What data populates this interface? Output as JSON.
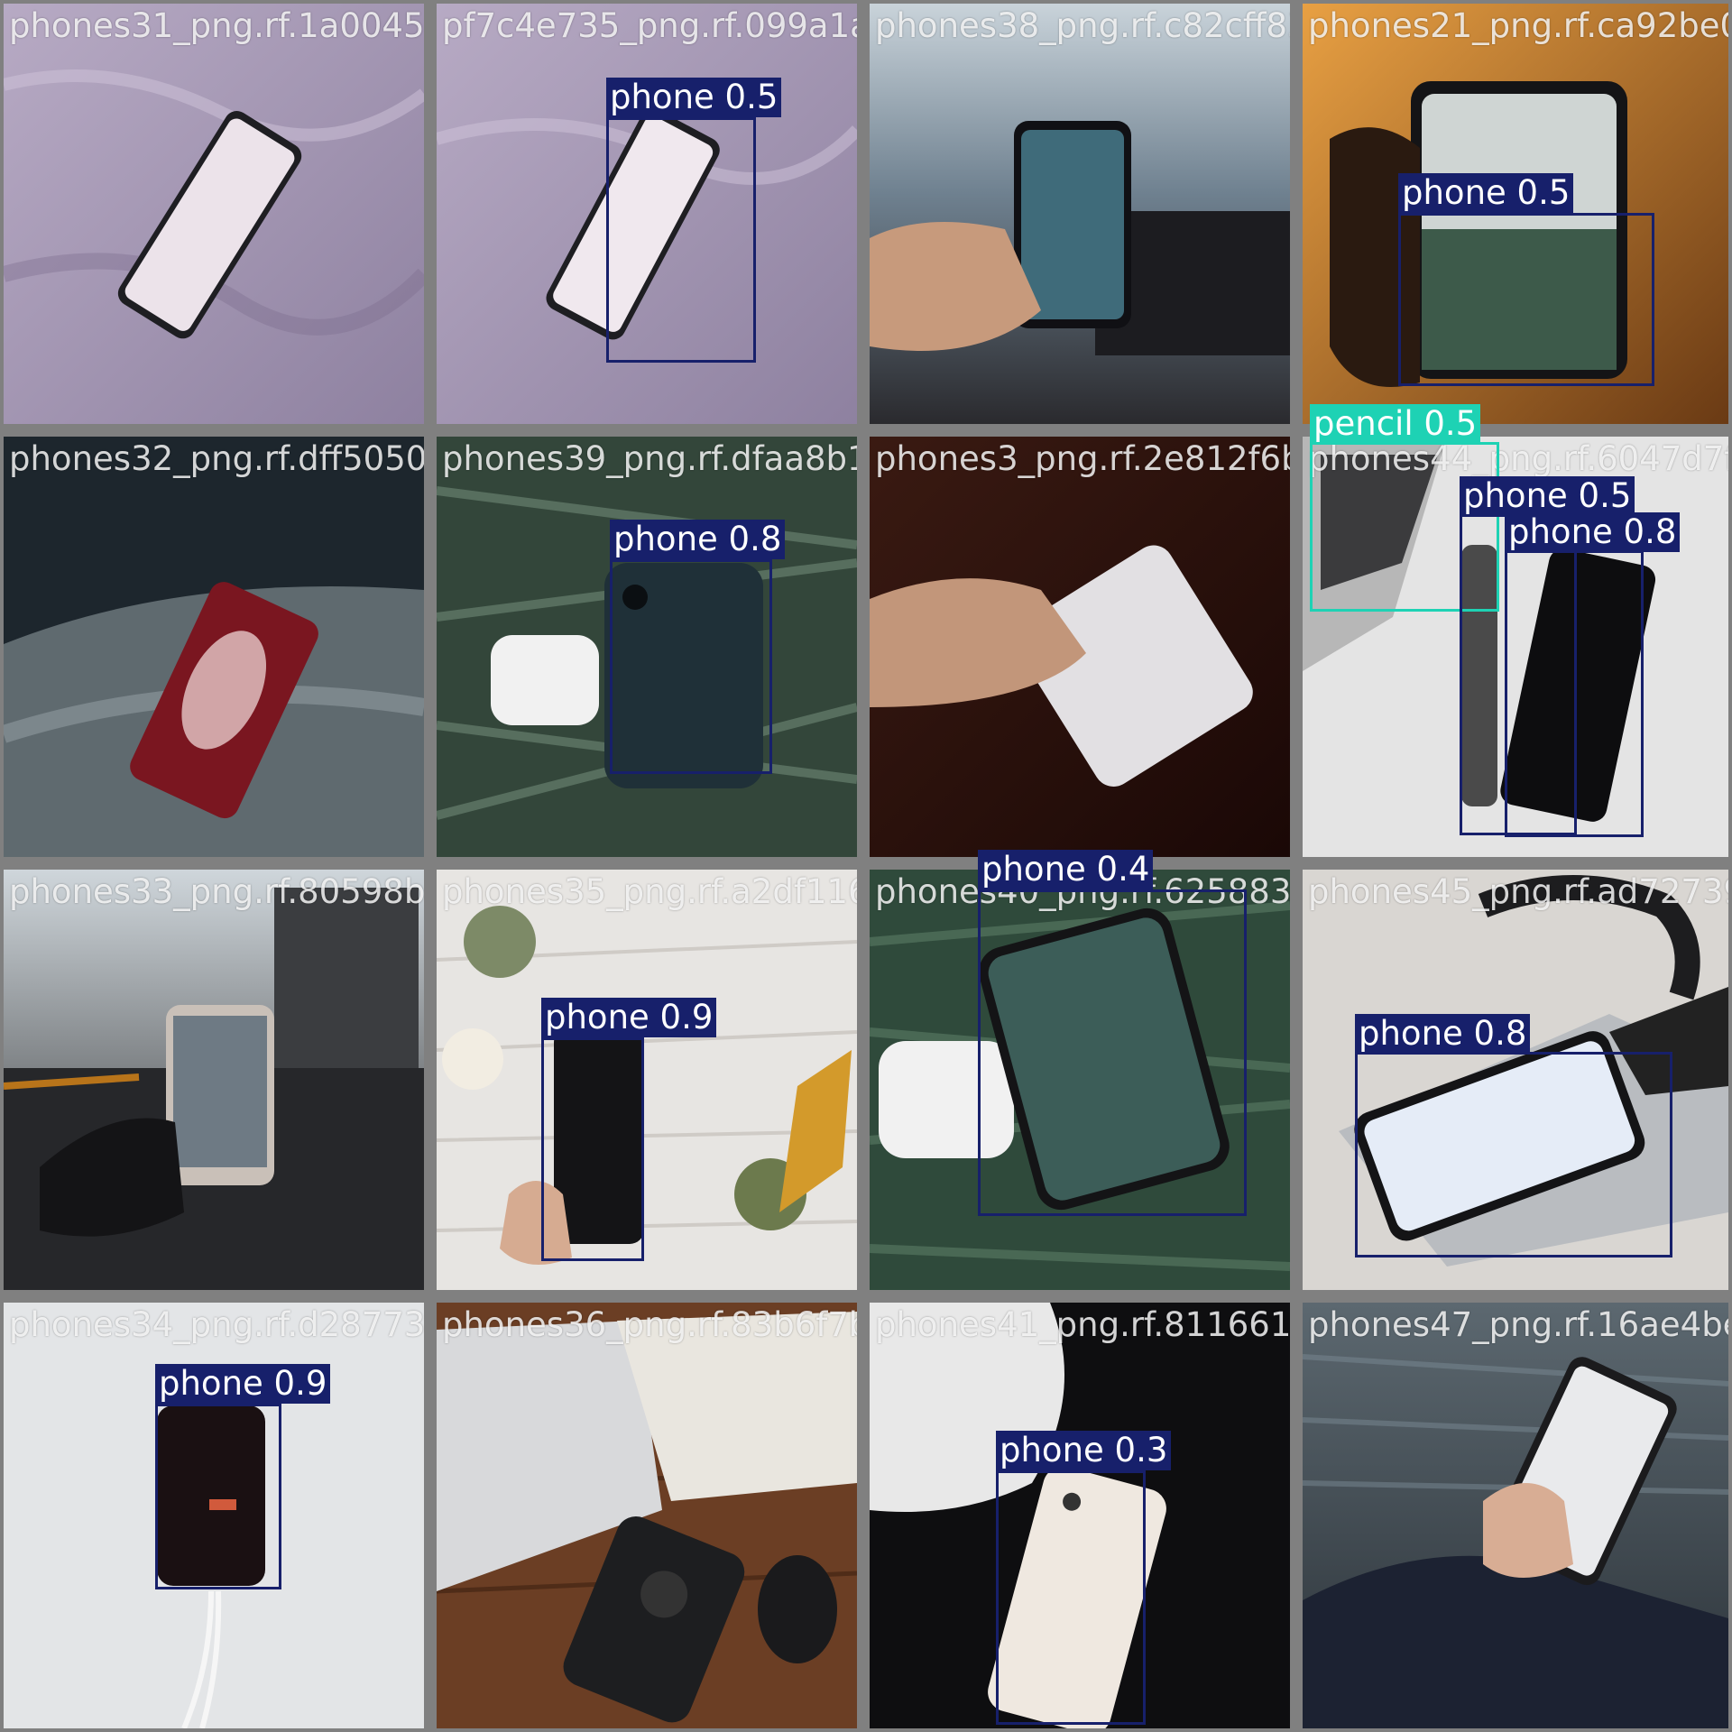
{
  "colors": {
    "phone": "#17206b",
    "pencil": "#1ed2b4",
    "frame": "#808080"
  },
  "tiles": [
    {
      "id": "t0",
      "filename": "phones31_png.rf.1a00450f2"
    },
    {
      "id": "t1",
      "filename": "pf7c4e735_png.rf.099a1a8187"
    },
    {
      "id": "t2",
      "filename": "phones38_png.rf.c82cff83c"
    },
    {
      "id": "t3",
      "filename": "phones21_png.rf.ca92be08ae"
    },
    {
      "id": "t4",
      "filename": "phones32_png.rf.dff50508a3"
    },
    {
      "id": "t5",
      "filename": "phones39_png.rf.dfaa8b10b"
    },
    {
      "id": "t6",
      "filename": "phones3_png.rf.2e812f6b2fc"
    },
    {
      "id": "t7",
      "filename": "phones44_png.rf.6047d7f69c"
    },
    {
      "id": "t8",
      "filename": "phones33_png.rf.80598bc6"
    },
    {
      "id": "t9",
      "filename": "phones35_png.rf.a2df1168d9"
    },
    {
      "id": "t10",
      "filename": "phones40_png.rf.62588310"
    },
    {
      "id": "t11",
      "filename": "phones45_png.rf.ad72739f3"
    },
    {
      "id": "t12",
      "filename": "phones34_png.rf.d28773b6"
    },
    {
      "id": "t13",
      "filename": "phones36_png.rf.83b6f7b93"
    },
    {
      "id": "t14",
      "filename": "phones41_png.rf.811661757"
    },
    {
      "id": "t15",
      "filename": "phones47_png.rf.16ae4be053"
    }
  ],
  "detections": [
    {
      "label": "phone 0.5",
      "cls": "phone"
    },
    {
      "label": "phone 0.5",
      "cls": "phone"
    },
    {
      "label": "phone 0.8",
      "cls": "phone"
    },
    {
      "label": "pencil 0.5",
      "cls": "pencil"
    },
    {
      "label": "phone 0.5",
      "cls": "phone"
    },
    {
      "label": "phone 0.8",
      "cls": "phone"
    },
    {
      "label": "phone 0.9",
      "cls": "phone"
    },
    {
      "label": "phone 0.4",
      "cls": "phone"
    },
    {
      "label": "phone 0.8",
      "cls": "phone"
    },
    {
      "label": "phone 0.9",
      "cls": "phone"
    },
    {
      "label": "phone 0.3",
      "cls": "phone"
    }
  ]
}
